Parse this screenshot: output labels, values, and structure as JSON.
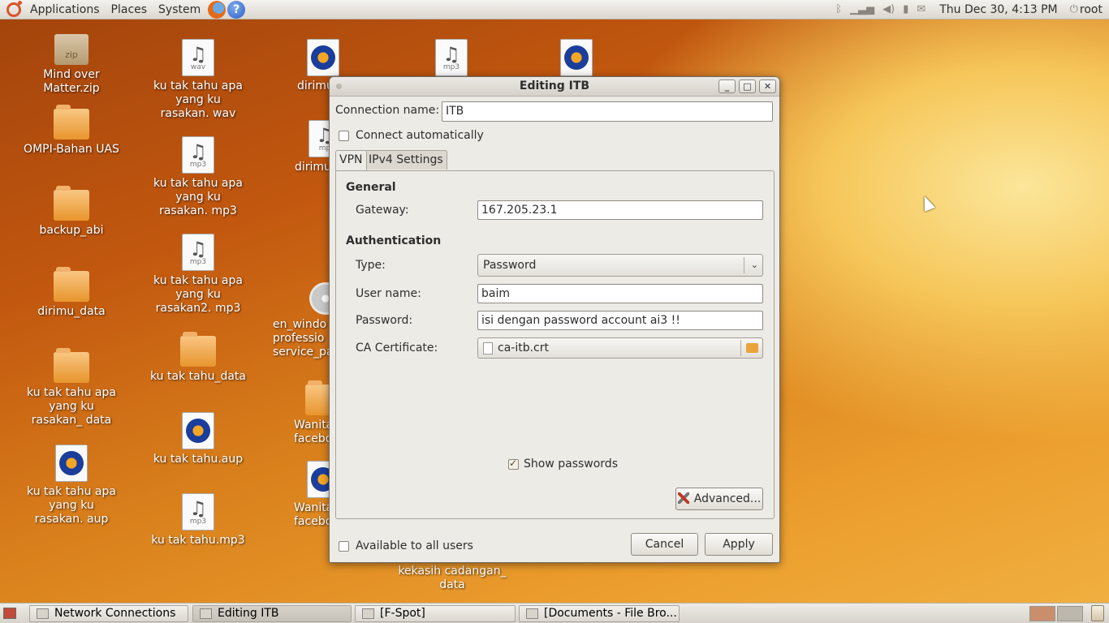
{
  "top_panel": {
    "menus": [
      "Applications",
      "Places",
      "System"
    ],
    "clock": "Thu Dec 30,  4:13 PM",
    "user": "root",
    "icons": [
      "ubuntu-logo-icon",
      "firefox-icon",
      "help-icon",
      "bluetooth-icon",
      "network-signal-icon",
      "volume-icon",
      "battery-icon",
      "mail-icon",
      "power-icon"
    ]
  },
  "desktop": {
    "icons": [
      {
        "label": "Mind over Matter.zip",
        "ext": "zip"
      },
      {
        "label": "OMPI-Bahan UAS"
      },
      {
        "label": "backup_abi"
      },
      {
        "label": "dirimu_data"
      },
      {
        "label": "ku tak tahu apa yang ku rasakan_ data"
      },
      {
        "label": "ku tak tahu apa yang ku rasakan. aup"
      },
      {
        "label": "ku tak tahu apa yang ku rasakan. wav",
        "ext": "wav"
      },
      {
        "label": "ku tak tahu apa yang ku rasakan. mp3",
        "ext": "mp3"
      },
      {
        "label": "ku tak tahu apa yang ku rasakan2. mp3",
        "ext": "mp3"
      },
      {
        "label": "ku tak tahu_data"
      },
      {
        "label": "ku tak tahu.aup"
      },
      {
        "label": "ku tak tahu.mp3",
        "ext": "mp3"
      },
      {
        "label": "dirimu"
      },
      {
        "label": "dirimu",
        "ext": "mp"
      },
      {
        "label": "en_windo professio service_pa"
      },
      {
        "label": "Wanita facebookn"
      },
      {
        "label": "Wanita facebook"
      },
      {
        "label": "kekasih cadangan_ data"
      },
      {
        "ext": "mp3"
      }
    ]
  },
  "dialog": {
    "title": "Editing ITB",
    "title_buttons": [
      "_",
      "□",
      "✕"
    ],
    "connection_name_label": "Connection name:",
    "connection_name_value": "ITB",
    "connect_auto_label": "Connect automatically",
    "connect_auto_checked": false,
    "tabs": [
      {
        "label": "VPN",
        "active": true
      },
      {
        "label": "IPv4 Settings",
        "active": false
      }
    ],
    "general_heading": "General",
    "gateway_label": "Gateway:",
    "gateway_value": "167.205.23.1",
    "auth_heading": "Authentication",
    "type_label": "Type:",
    "type_value": "Password",
    "username_label": "User name:",
    "username_value": "baim",
    "password_label": "Password:",
    "password_value": "isi dengan password account ai3 !!",
    "ca_label": "CA Certificate:",
    "ca_value": "ca-itb.crt",
    "show_passwords_label": "Show passwords",
    "show_passwords_checked": true,
    "advanced_button": "Advanced...",
    "available_all_label": "Available to all users",
    "available_all_checked": false,
    "cancel_button": "Cancel",
    "apply_button": "Apply"
  },
  "taskbar": {
    "tasks": [
      {
        "label": "Network Connections",
        "active": false
      },
      {
        "label": "Editing ITB",
        "active": true
      },
      {
        "label": "[F-Spot]",
        "active": false
      },
      {
        "label": "[Documents - File Bro...",
        "active": false
      }
    ]
  }
}
